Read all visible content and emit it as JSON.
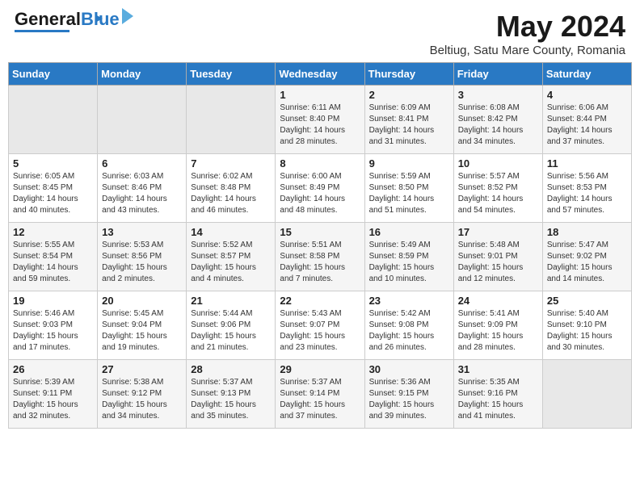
{
  "header": {
    "logo_general": "General",
    "logo_blue": "Blue",
    "title": "May 2024",
    "subtitle": "Beltiug, Satu Mare County, Romania"
  },
  "days_of_week": [
    "Sunday",
    "Monday",
    "Tuesday",
    "Wednesday",
    "Thursday",
    "Friday",
    "Saturday"
  ],
  "weeks": [
    [
      {
        "day": "",
        "info": ""
      },
      {
        "day": "",
        "info": ""
      },
      {
        "day": "",
        "info": ""
      },
      {
        "day": "1",
        "info": "Sunrise: 6:11 AM\nSunset: 8:40 PM\nDaylight: 14 hours\nand 28 minutes."
      },
      {
        "day": "2",
        "info": "Sunrise: 6:09 AM\nSunset: 8:41 PM\nDaylight: 14 hours\nand 31 minutes."
      },
      {
        "day": "3",
        "info": "Sunrise: 6:08 AM\nSunset: 8:42 PM\nDaylight: 14 hours\nand 34 minutes."
      },
      {
        "day": "4",
        "info": "Sunrise: 6:06 AM\nSunset: 8:44 PM\nDaylight: 14 hours\nand 37 minutes."
      }
    ],
    [
      {
        "day": "5",
        "info": "Sunrise: 6:05 AM\nSunset: 8:45 PM\nDaylight: 14 hours\nand 40 minutes."
      },
      {
        "day": "6",
        "info": "Sunrise: 6:03 AM\nSunset: 8:46 PM\nDaylight: 14 hours\nand 43 minutes."
      },
      {
        "day": "7",
        "info": "Sunrise: 6:02 AM\nSunset: 8:48 PM\nDaylight: 14 hours\nand 46 minutes."
      },
      {
        "day": "8",
        "info": "Sunrise: 6:00 AM\nSunset: 8:49 PM\nDaylight: 14 hours\nand 48 minutes."
      },
      {
        "day": "9",
        "info": "Sunrise: 5:59 AM\nSunset: 8:50 PM\nDaylight: 14 hours\nand 51 minutes."
      },
      {
        "day": "10",
        "info": "Sunrise: 5:57 AM\nSunset: 8:52 PM\nDaylight: 14 hours\nand 54 minutes."
      },
      {
        "day": "11",
        "info": "Sunrise: 5:56 AM\nSunset: 8:53 PM\nDaylight: 14 hours\nand 57 minutes."
      }
    ],
    [
      {
        "day": "12",
        "info": "Sunrise: 5:55 AM\nSunset: 8:54 PM\nDaylight: 14 hours\nand 59 minutes."
      },
      {
        "day": "13",
        "info": "Sunrise: 5:53 AM\nSunset: 8:56 PM\nDaylight: 15 hours\nand 2 minutes."
      },
      {
        "day": "14",
        "info": "Sunrise: 5:52 AM\nSunset: 8:57 PM\nDaylight: 15 hours\nand 4 minutes."
      },
      {
        "day": "15",
        "info": "Sunrise: 5:51 AM\nSunset: 8:58 PM\nDaylight: 15 hours\nand 7 minutes."
      },
      {
        "day": "16",
        "info": "Sunrise: 5:49 AM\nSunset: 8:59 PM\nDaylight: 15 hours\nand 10 minutes."
      },
      {
        "day": "17",
        "info": "Sunrise: 5:48 AM\nSunset: 9:01 PM\nDaylight: 15 hours\nand 12 minutes."
      },
      {
        "day": "18",
        "info": "Sunrise: 5:47 AM\nSunset: 9:02 PM\nDaylight: 15 hours\nand 14 minutes."
      }
    ],
    [
      {
        "day": "19",
        "info": "Sunrise: 5:46 AM\nSunset: 9:03 PM\nDaylight: 15 hours\nand 17 minutes."
      },
      {
        "day": "20",
        "info": "Sunrise: 5:45 AM\nSunset: 9:04 PM\nDaylight: 15 hours\nand 19 minutes."
      },
      {
        "day": "21",
        "info": "Sunrise: 5:44 AM\nSunset: 9:06 PM\nDaylight: 15 hours\nand 21 minutes."
      },
      {
        "day": "22",
        "info": "Sunrise: 5:43 AM\nSunset: 9:07 PM\nDaylight: 15 hours\nand 23 minutes."
      },
      {
        "day": "23",
        "info": "Sunrise: 5:42 AM\nSunset: 9:08 PM\nDaylight: 15 hours\nand 26 minutes."
      },
      {
        "day": "24",
        "info": "Sunrise: 5:41 AM\nSunset: 9:09 PM\nDaylight: 15 hours\nand 28 minutes."
      },
      {
        "day": "25",
        "info": "Sunrise: 5:40 AM\nSunset: 9:10 PM\nDaylight: 15 hours\nand 30 minutes."
      }
    ],
    [
      {
        "day": "26",
        "info": "Sunrise: 5:39 AM\nSunset: 9:11 PM\nDaylight: 15 hours\nand 32 minutes."
      },
      {
        "day": "27",
        "info": "Sunrise: 5:38 AM\nSunset: 9:12 PM\nDaylight: 15 hours\nand 34 minutes."
      },
      {
        "day": "28",
        "info": "Sunrise: 5:37 AM\nSunset: 9:13 PM\nDaylight: 15 hours\nand 35 minutes."
      },
      {
        "day": "29",
        "info": "Sunrise: 5:37 AM\nSunset: 9:14 PM\nDaylight: 15 hours\nand 37 minutes."
      },
      {
        "day": "30",
        "info": "Sunrise: 5:36 AM\nSunset: 9:15 PM\nDaylight: 15 hours\nand 39 minutes."
      },
      {
        "day": "31",
        "info": "Sunrise: 5:35 AM\nSunset: 9:16 PM\nDaylight: 15 hours\nand 41 minutes."
      },
      {
        "day": "",
        "info": ""
      }
    ]
  ]
}
